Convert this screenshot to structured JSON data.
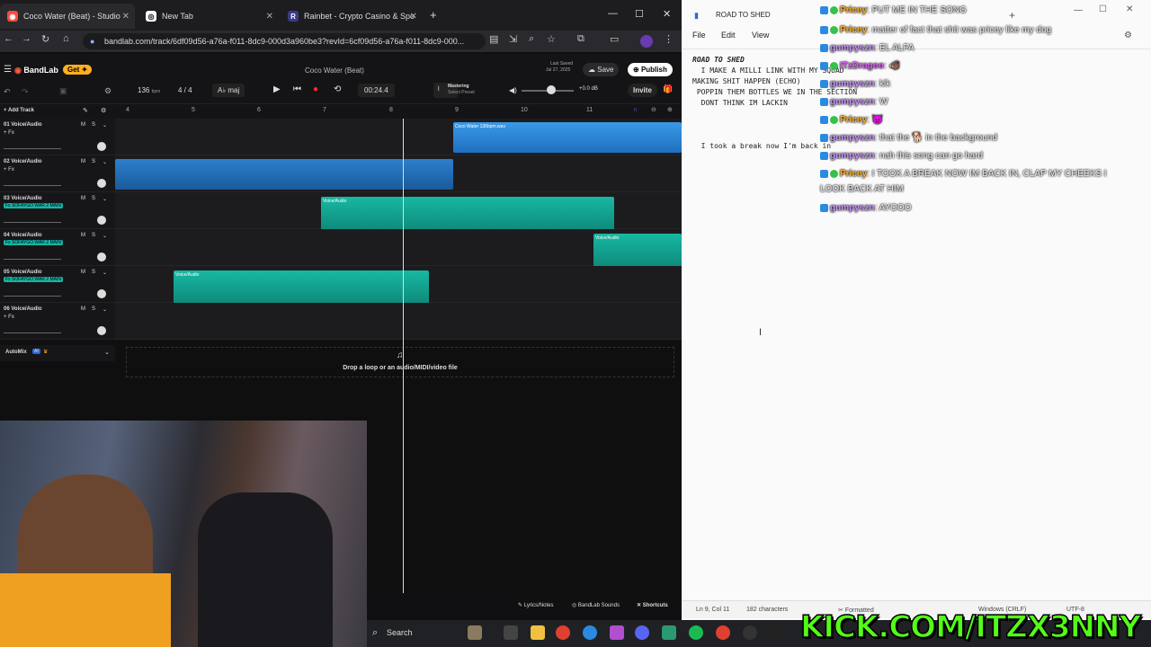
{
  "browser": {
    "tabs": [
      {
        "label": "Coco Water (Beat) - Studio",
        "active": true
      },
      {
        "label": "New Tab",
        "active": false
      },
      {
        "label": "Rainbet - Crypto Casino & Spo",
        "active": false
      }
    ],
    "url": "bandlab.com/track/6df09d56-a76a-f011-8dc9-000d3a960be3?revId=6cf09d56-a76a-f011-8dc9-000..."
  },
  "bandlab": {
    "logo": "BandLab",
    "get": "Get",
    "project_title": "Coco Water (Beat)",
    "last_saved_label": "Last Saved",
    "last_saved_date": "Jul 27, 2025",
    "save": "Save",
    "publish": "Publish",
    "bpm": "136",
    "bpm_unit": "bpm",
    "time_sig": "4 / 4",
    "key": "maj",
    "time": "00:24.4",
    "mastering": "Mastering",
    "select_preset": "Select Preset",
    "volume_db": "+0.0 dB",
    "invite": "Invite",
    "add_track": "Add Track",
    "ruler": [
      "4",
      "5",
      "6",
      "7",
      "8",
      "9",
      "10",
      "11"
    ],
    "tracks": [
      {
        "num": "01",
        "name": "Voice/Audio",
        "fx": "+ Fx",
        "fx_highlight": false
      },
      {
        "num": "02",
        "name": "Voice/Audio",
        "fx": "+ Fx",
        "fx_highlight": false
      },
      {
        "num": "03",
        "name": "Voice/Audio",
        "fx": "Fx SOFAYGO WAR 2 MAIN",
        "fx_highlight": true
      },
      {
        "num": "04",
        "name": "Voice/Audio",
        "fx": "Fx SOFAYGO WAR 2 MAIN",
        "fx_highlight": true
      },
      {
        "num": "05",
        "name": "Voice/Audio",
        "fx": "Fx SOFAYGO WAR 2 MAIN",
        "fx_highlight": true
      },
      {
        "num": "06",
        "name": "Voice/Audio",
        "fx": "+ Fx",
        "fx_highlight": false
      }
    ],
    "clips": {
      "c1": "Coco Water 136bpm.wav",
      "c3": "Voice/Audio",
      "c4": "Voice/Audio",
      "c5": "Voice/Audio"
    },
    "automix": "AutoMix",
    "ai": "AI",
    "drop_text": "Drop a loop or an audio/MIDI/video file",
    "bottom": {
      "lyrics": "Lyrics/Notes",
      "sounds": "BandLab Sounds",
      "shortcuts": "Shortcuts"
    }
  },
  "notepad": {
    "title": "ROAD TO SHED",
    "menu": [
      "File",
      "Edit",
      "View"
    ],
    "lines": [
      "ROAD TO SHED",
      "  I MAKE A MILLI LINK WITH MY SQUAD",
      "MAKING SHIT HAPPEN (ECHO)",
      " POPPIN THEM BOTTLES WE IN THE SECTION",
      "  DONT THINK IM LACKIN"
    ],
    "extra_line": "  I took a break now I'm back in",
    "status_pos": "Ln 9, Col 11",
    "status_chars": "182 characters",
    "status_format": "Formatted",
    "status_enc": "UTF-8",
    "status_le": "Windows (CRLF)"
  },
  "chat": [
    {
      "user": "Pricey",
      "msg": ": PUT ME IN THE SONG",
      "color": "u1"
    },
    {
      "user": "Pricey",
      "msg": ": matter of fact that shit was pricey like my dog",
      "color": "u1"
    },
    {
      "user": "gumpyszn",
      "msg": ": EL ALFA",
      "color": "u2"
    },
    {
      "user": "ITzDragoo",
      "msg": ": 🐗",
      "color": "u3"
    },
    {
      "user": "gumpyszn",
      "msg": ": klk",
      "color": "u2"
    },
    {
      "user": "gumpyszn",
      "msg": ": W",
      "color": "u2"
    },
    {
      "user": "Pricey",
      "msg": ": 😈",
      "color": "u1"
    },
    {
      "user": "gumpyszn",
      "msg": ": that the 🐕 in the background",
      "color": "u2"
    },
    {
      "user": "gumpyszn",
      "msg": ": nah this song can go hard",
      "color": "u2"
    },
    {
      "user": "Pricey",
      "msg": ": I TOOK A BREAK NOW IM BACK IN, CLAP MY CHEEKS I",
      "color": "u1"
    },
    {
      "user": "",
      "msg": "LOOK BACK AT HIM",
      "color": "u1"
    },
    {
      "user": "gumpyszn",
      "msg": ": AYOOO",
      "color": "u2"
    }
  ],
  "taskbar": {
    "search": "Search"
  },
  "overlay": {
    "kick": "KICK.COM/ITZX3NNY"
  },
  "colors": {
    "accent": "#ff5a36",
    "clip_blue": "#2b86d6",
    "clip_teal": "#16b6a0",
    "kick_green": "#53fc18"
  }
}
